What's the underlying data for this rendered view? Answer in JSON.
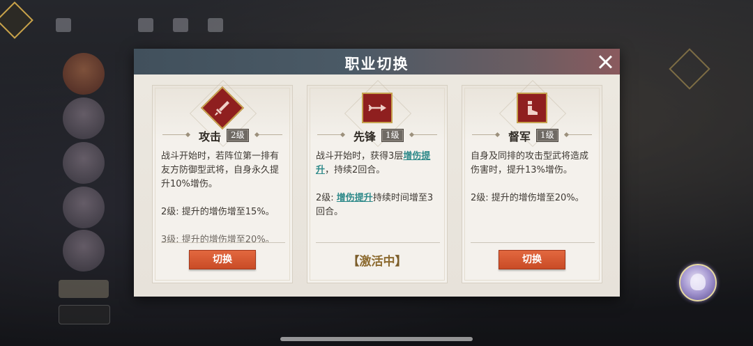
{
  "dialog": {
    "title": "职业切换"
  },
  "cards": [
    {
      "name": "攻击",
      "level": "2级",
      "desc_lines": [
        "战斗开始时，若阵位第一排有友方防御型武将，自身永久提升10%增伤。"
      ],
      "level2": "2级: 提升的增伤增至15%。",
      "level3": "3级: 提升的增伤增至20%。",
      "button": "切换",
      "icon": "sword-emblem-icon"
    },
    {
      "name": "先锋",
      "level": "1级",
      "desc_pre": "战斗开始时，获得3层",
      "desc_link": "增伤提升",
      "desc_post": "，持续2回合。",
      "level2_pre": "2级: ",
      "level2_link": "增伤提升",
      "level2_post": "持续时间增至3回合。",
      "status": "激活中",
      "bracket_left": "【",
      "bracket_right": "】",
      "icon": "spear-icon"
    },
    {
      "name": "督军",
      "level": "1级",
      "desc": "自身及同排的攻击型武将造成伤害时，提升13%增伤。",
      "level2": "2级: 提升的增伤增至20%。",
      "button": "切换",
      "icon": "horn-icon"
    }
  ],
  "colors": {
    "accent_button": "#d45a30",
    "link": "#2f8a8a",
    "icon_bg": "#8f1f1f",
    "header": "#45535e"
  }
}
